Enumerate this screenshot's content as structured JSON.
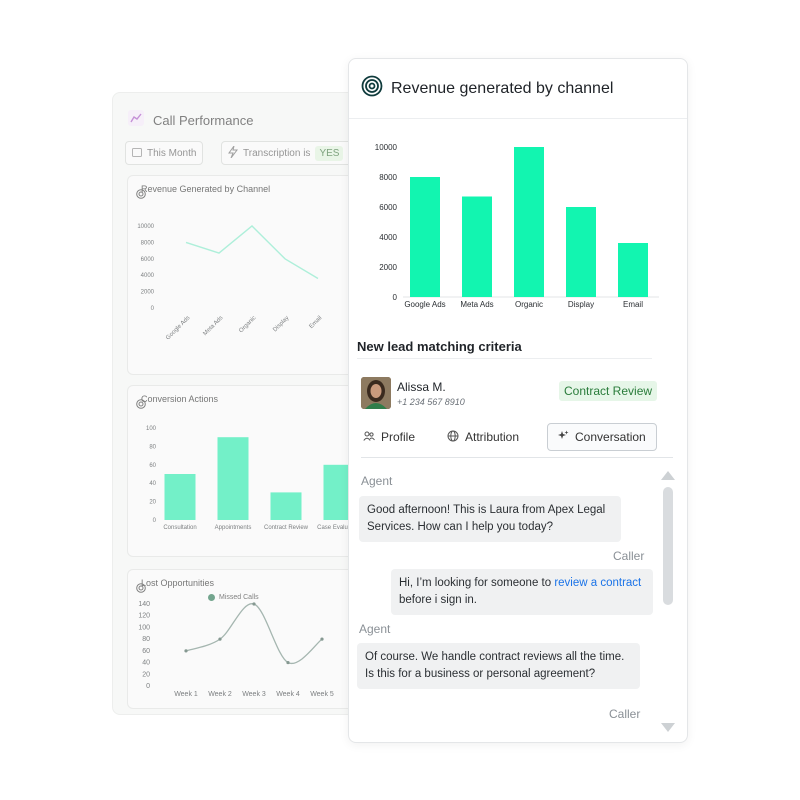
{
  "back_panel": {
    "title": "Call Performance",
    "date_filter": "This Month",
    "transcription_label": "Transcription is",
    "transcription_value": "YES",
    "cards": [
      {
        "title": "Revenue Generated by Channel"
      },
      {
        "title": "Conversion Actions"
      },
      {
        "title": "Lost Opportunities"
      }
    ]
  },
  "front_panel": {
    "chart_title": "Revenue generated by channel",
    "section_title": "New lead matching criteria",
    "lead": {
      "name": "Alissa M.",
      "phone": "+1 234 567 8910",
      "status": "Contract Review"
    },
    "tabs": [
      {
        "label": "Profile",
        "icon": "users-icon"
      },
      {
        "label": "Attribution",
        "icon": "globe-icon"
      },
      {
        "label": "Conversation",
        "icon": "sparkle-icon",
        "active": true
      }
    ],
    "messages": [
      {
        "role": "Agent",
        "text": "Good afternoon! This is Laura from Apex Legal Services. How can I help you today?"
      },
      {
        "role": "Caller",
        "text_before": "Hi, I’m looking for someone to ",
        "link": "review a contract",
        "text_after": " before i sign in."
      },
      {
        "role": "Agent",
        "text": "Of course. We handle contract reviews all the time. Is this for a business or personal agreement?"
      },
      {
        "role": "Caller",
        "text": ""
      }
    ]
  },
  "colors": {
    "accent": "#12f5b0",
    "accent_back": "#1ee8a8",
    "line_back": "#7ee6c4",
    "dark_line": "#6f8a80"
  },
  "chart_data": [
    {
      "type": "bar",
      "title": "Revenue generated by channel",
      "categories": [
        "Google Ads",
        "Meta Ads",
        "Organic",
        "Display",
        "Email"
      ],
      "values": [
        8000,
        6700,
        10000,
        6000,
        3600
      ],
      "yticks": [
        0,
        2000,
        4000,
        6000,
        8000,
        10000
      ],
      "ylim": [
        0,
        10000
      ],
      "grid": false
    },
    {
      "type": "line",
      "title": "Revenue Generated by Channel",
      "categories": [
        "Google Ads",
        "Meta Ads",
        "Organic",
        "Display",
        "Email"
      ],
      "values": [
        8000,
        6700,
        10000,
        6000,
        3600
      ],
      "yticks": [
        0,
        2000,
        4000,
        6000,
        8000,
        10000
      ],
      "ylim": [
        0,
        10000
      ]
    },
    {
      "type": "bar",
      "title": "Conversion Actions",
      "categories": [
        "Consultation",
        "Appointments",
        "Contract Review",
        "Case Evaluation"
      ],
      "values": [
        50,
        90,
        30,
        60
      ],
      "yticks": [
        0,
        20,
        40,
        60,
        80,
        100
      ],
      "ylim": [
        0,
        100
      ]
    },
    {
      "type": "line",
      "title": "Lost Opportunities",
      "categories": [
        "Week 1",
        "Week 2",
        "Week 3",
        "Week 4",
        "Week 5"
      ],
      "series": [
        {
          "name": "Missed Calls",
          "values": [
            60,
            80,
            140,
            40,
            80
          ]
        }
      ],
      "yticks": [
        0,
        20,
        40,
        60,
        80,
        100,
        120,
        140
      ],
      "ylim": [
        0,
        140
      ]
    }
  ]
}
